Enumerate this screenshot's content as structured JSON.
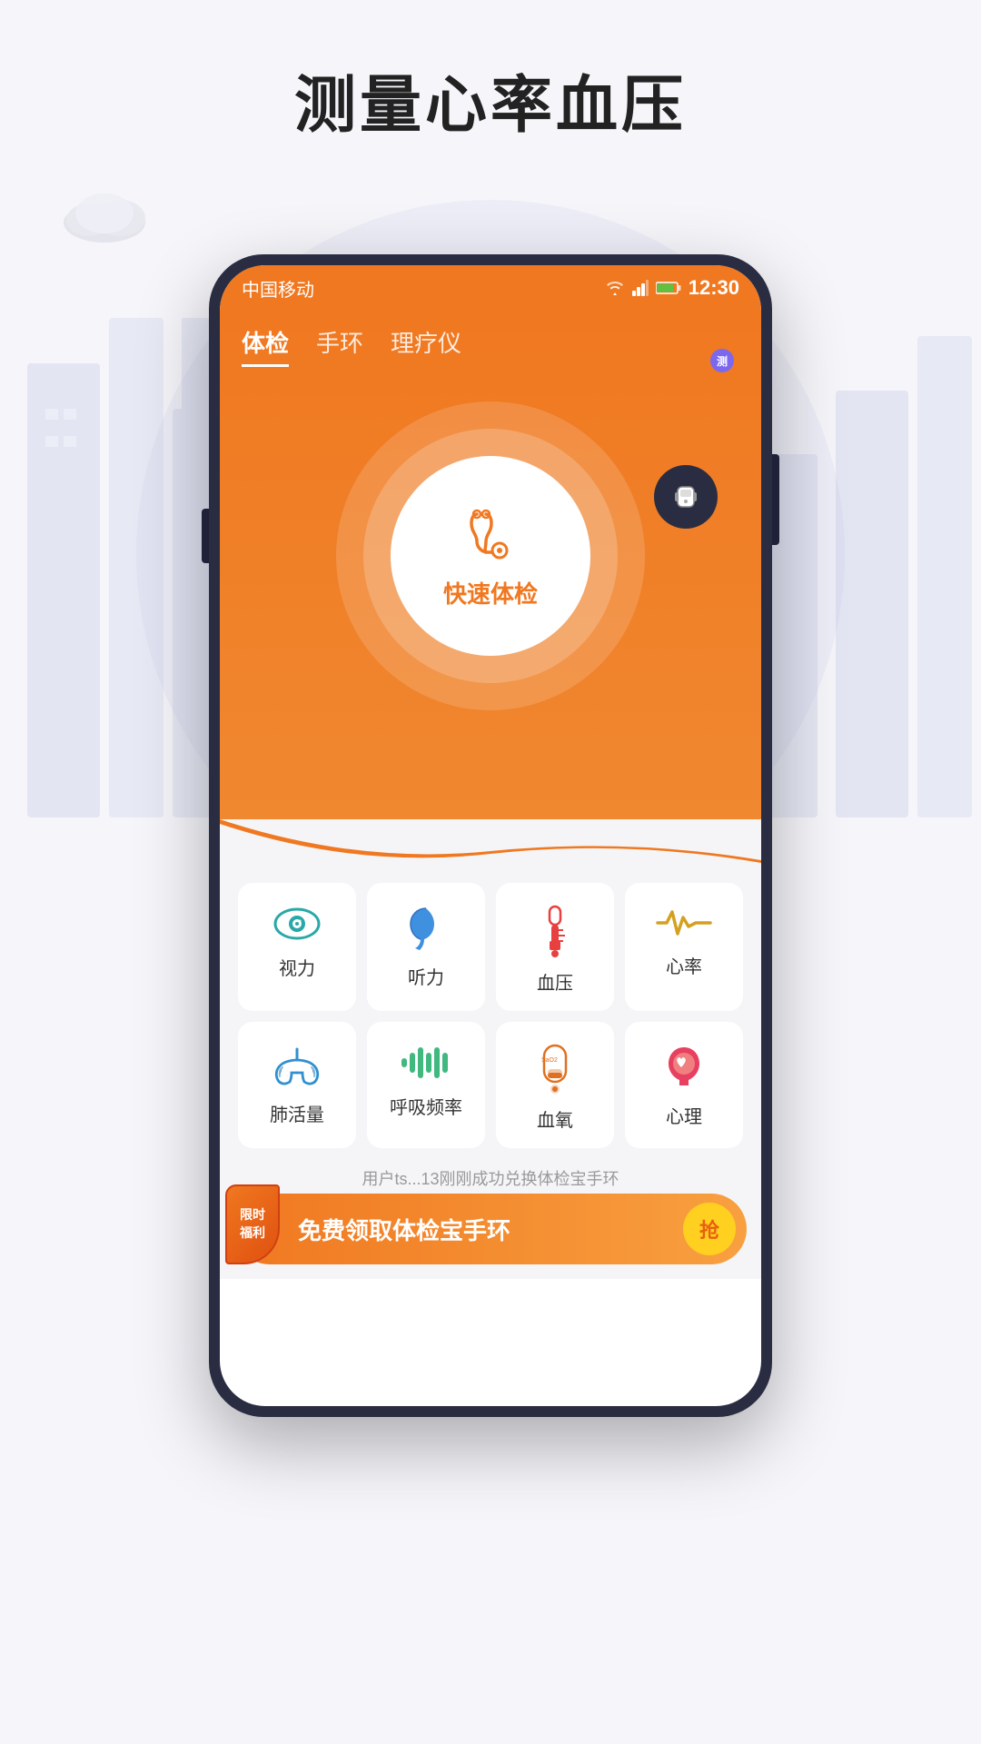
{
  "app": {
    "title": "测量心率血压"
  },
  "background": {
    "circle_color": "#e8e8f5"
  },
  "status_bar": {
    "carrier": "中国移动",
    "time": "12:30",
    "wifi_icon": "wifi",
    "signal_icon": "signal",
    "battery_icon": "battery"
  },
  "tabs": [
    {
      "id": "physical",
      "label": "体检",
      "active": true
    },
    {
      "id": "bracelet",
      "label": "手环",
      "active": false
    },
    {
      "id": "therapy",
      "label": "理疗仪",
      "active": false
    }
  ],
  "band_button": {
    "badge_label": "测"
  },
  "center_button": {
    "label": "快速体检"
  },
  "health_items": [
    {
      "id": "vision",
      "label": "视力",
      "icon_type": "eye"
    },
    {
      "id": "hearing",
      "label": "听力",
      "icon_type": "ear"
    },
    {
      "id": "bloodpressure",
      "label": "血压",
      "icon_type": "thermometer"
    },
    {
      "id": "heartrate",
      "label": "心率",
      "icon_type": "heartrate"
    },
    {
      "id": "lung",
      "label": "肺活量",
      "icon_type": "lung"
    },
    {
      "id": "breath",
      "label": "呼吸频率",
      "icon_type": "breath"
    },
    {
      "id": "spo2",
      "label": "血氧",
      "icon_type": "spo2"
    },
    {
      "id": "mental",
      "label": "心理",
      "icon_type": "mental"
    }
  ],
  "notification_text": "用户ts...13刚刚成功兑换体检宝手环",
  "banner": {
    "limited_label": "限时\n福利",
    "main_text": "免费领取体检宝手环",
    "grab_label": "抢"
  }
}
